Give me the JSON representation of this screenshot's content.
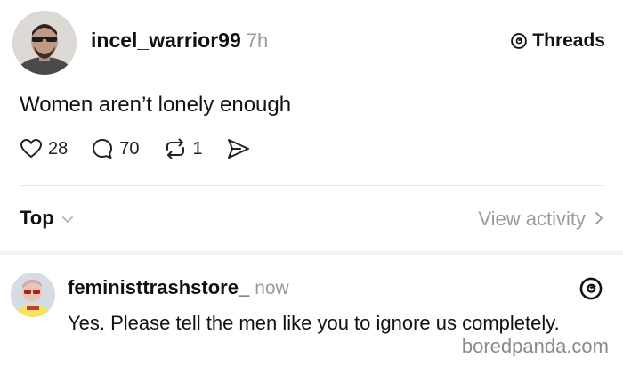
{
  "post": {
    "username": "incel_warrior99",
    "time": "7h",
    "brand": "Threads",
    "text": "Women aren’t lonely enough",
    "likes": "28",
    "replies": "70",
    "reposts": "1"
  },
  "sort": {
    "label": "Top",
    "view_activity": "View activity"
  },
  "reply": {
    "username": "feministtrashstore_",
    "time": "now",
    "text": "Yes. Please tell the men like you to ignore us completely."
  },
  "watermark": "boredpanda.com",
  "icons": {
    "like": "heart-icon",
    "reply": "comment-icon",
    "repost": "repost-icon",
    "share": "send-icon",
    "brand": "threads-logo-icon"
  },
  "colors": {
    "text": "#111111",
    "muted": "#9a9a9a",
    "divider": "#e3e3e3"
  }
}
